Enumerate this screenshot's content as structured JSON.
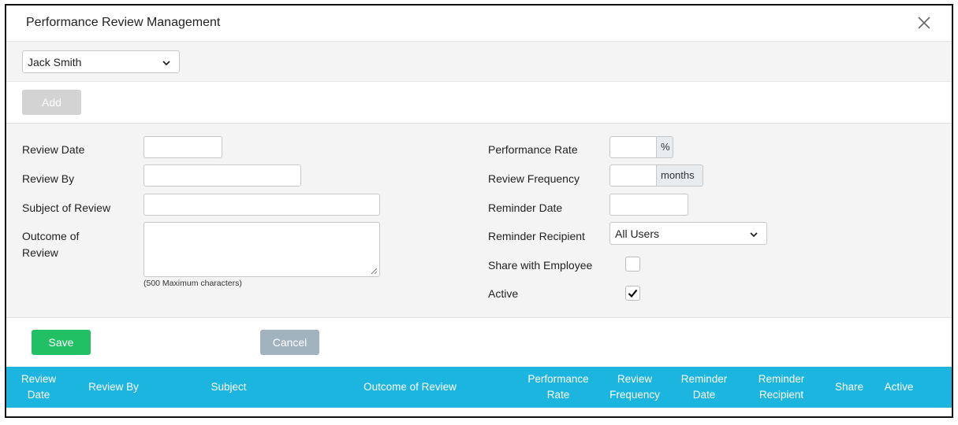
{
  "dialog": {
    "title": "Performance Review Management"
  },
  "employee_select": {
    "value": "Jack Smith"
  },
  "toolbar": {
    "add_label": "Add"
  },
  "form": {
    "review_date_label": "Review Date",
    "review_by_label": "Review By",
    "subject_label": "Subject of Review",
    "outcome_label_line1": "Outcome of",
    "outcome_label_line2": "Review",
    "outcome_hint": "(500 Maximum characters)",
    "performance_rate_label": "Performance Rate",
    "performance_rate_unit": "%",
    "review_frequency_label": "Review Frequency",
    "review_frequency_unit": "months",
    "reminder_date_label": "Reminder Date",
    "reminder_recipient_label": "Reminder Recipient",
    "reminder_recipient_value": "All Users",
    "share_label": "Share with Employee",
    "share_checked": false,
    "active_label": "Active",
    "active_checked": true
  },
  "actions": {
    "save_label": "Save",
    "cancel_label": "Cancel"
  },
  "table": {
    "headers": [
      [
        "Review",
        "Date"
      ],
      [
        "Review By"
      ],
      [
        "Subject"
      ],
      [
        "Outcome of Review"
      ],
      [
        "Performance",
        "Rate"
      ],
      [
        "Review",
        "Frequency"
      ],
      [
        "Reminder",
        "Date"
      ],
      [
        "Reminder",
        "Recipient"
      ],
      [
        "Share"
      ],
      [
        "Active"
      ]
    ]
  },
  "colors": {
    "header_bg": "#1cb5e0",
    "save_bg": "#22c065",
    "cancel_bg": "#a1b3bf",
    "add_bg": "#d3d3d3"
  },
  "icons": {
    "close": "close-icon",
    "dropdown": "chevron-down-icon",
    "check": "checkmark-icon"
  }
}
